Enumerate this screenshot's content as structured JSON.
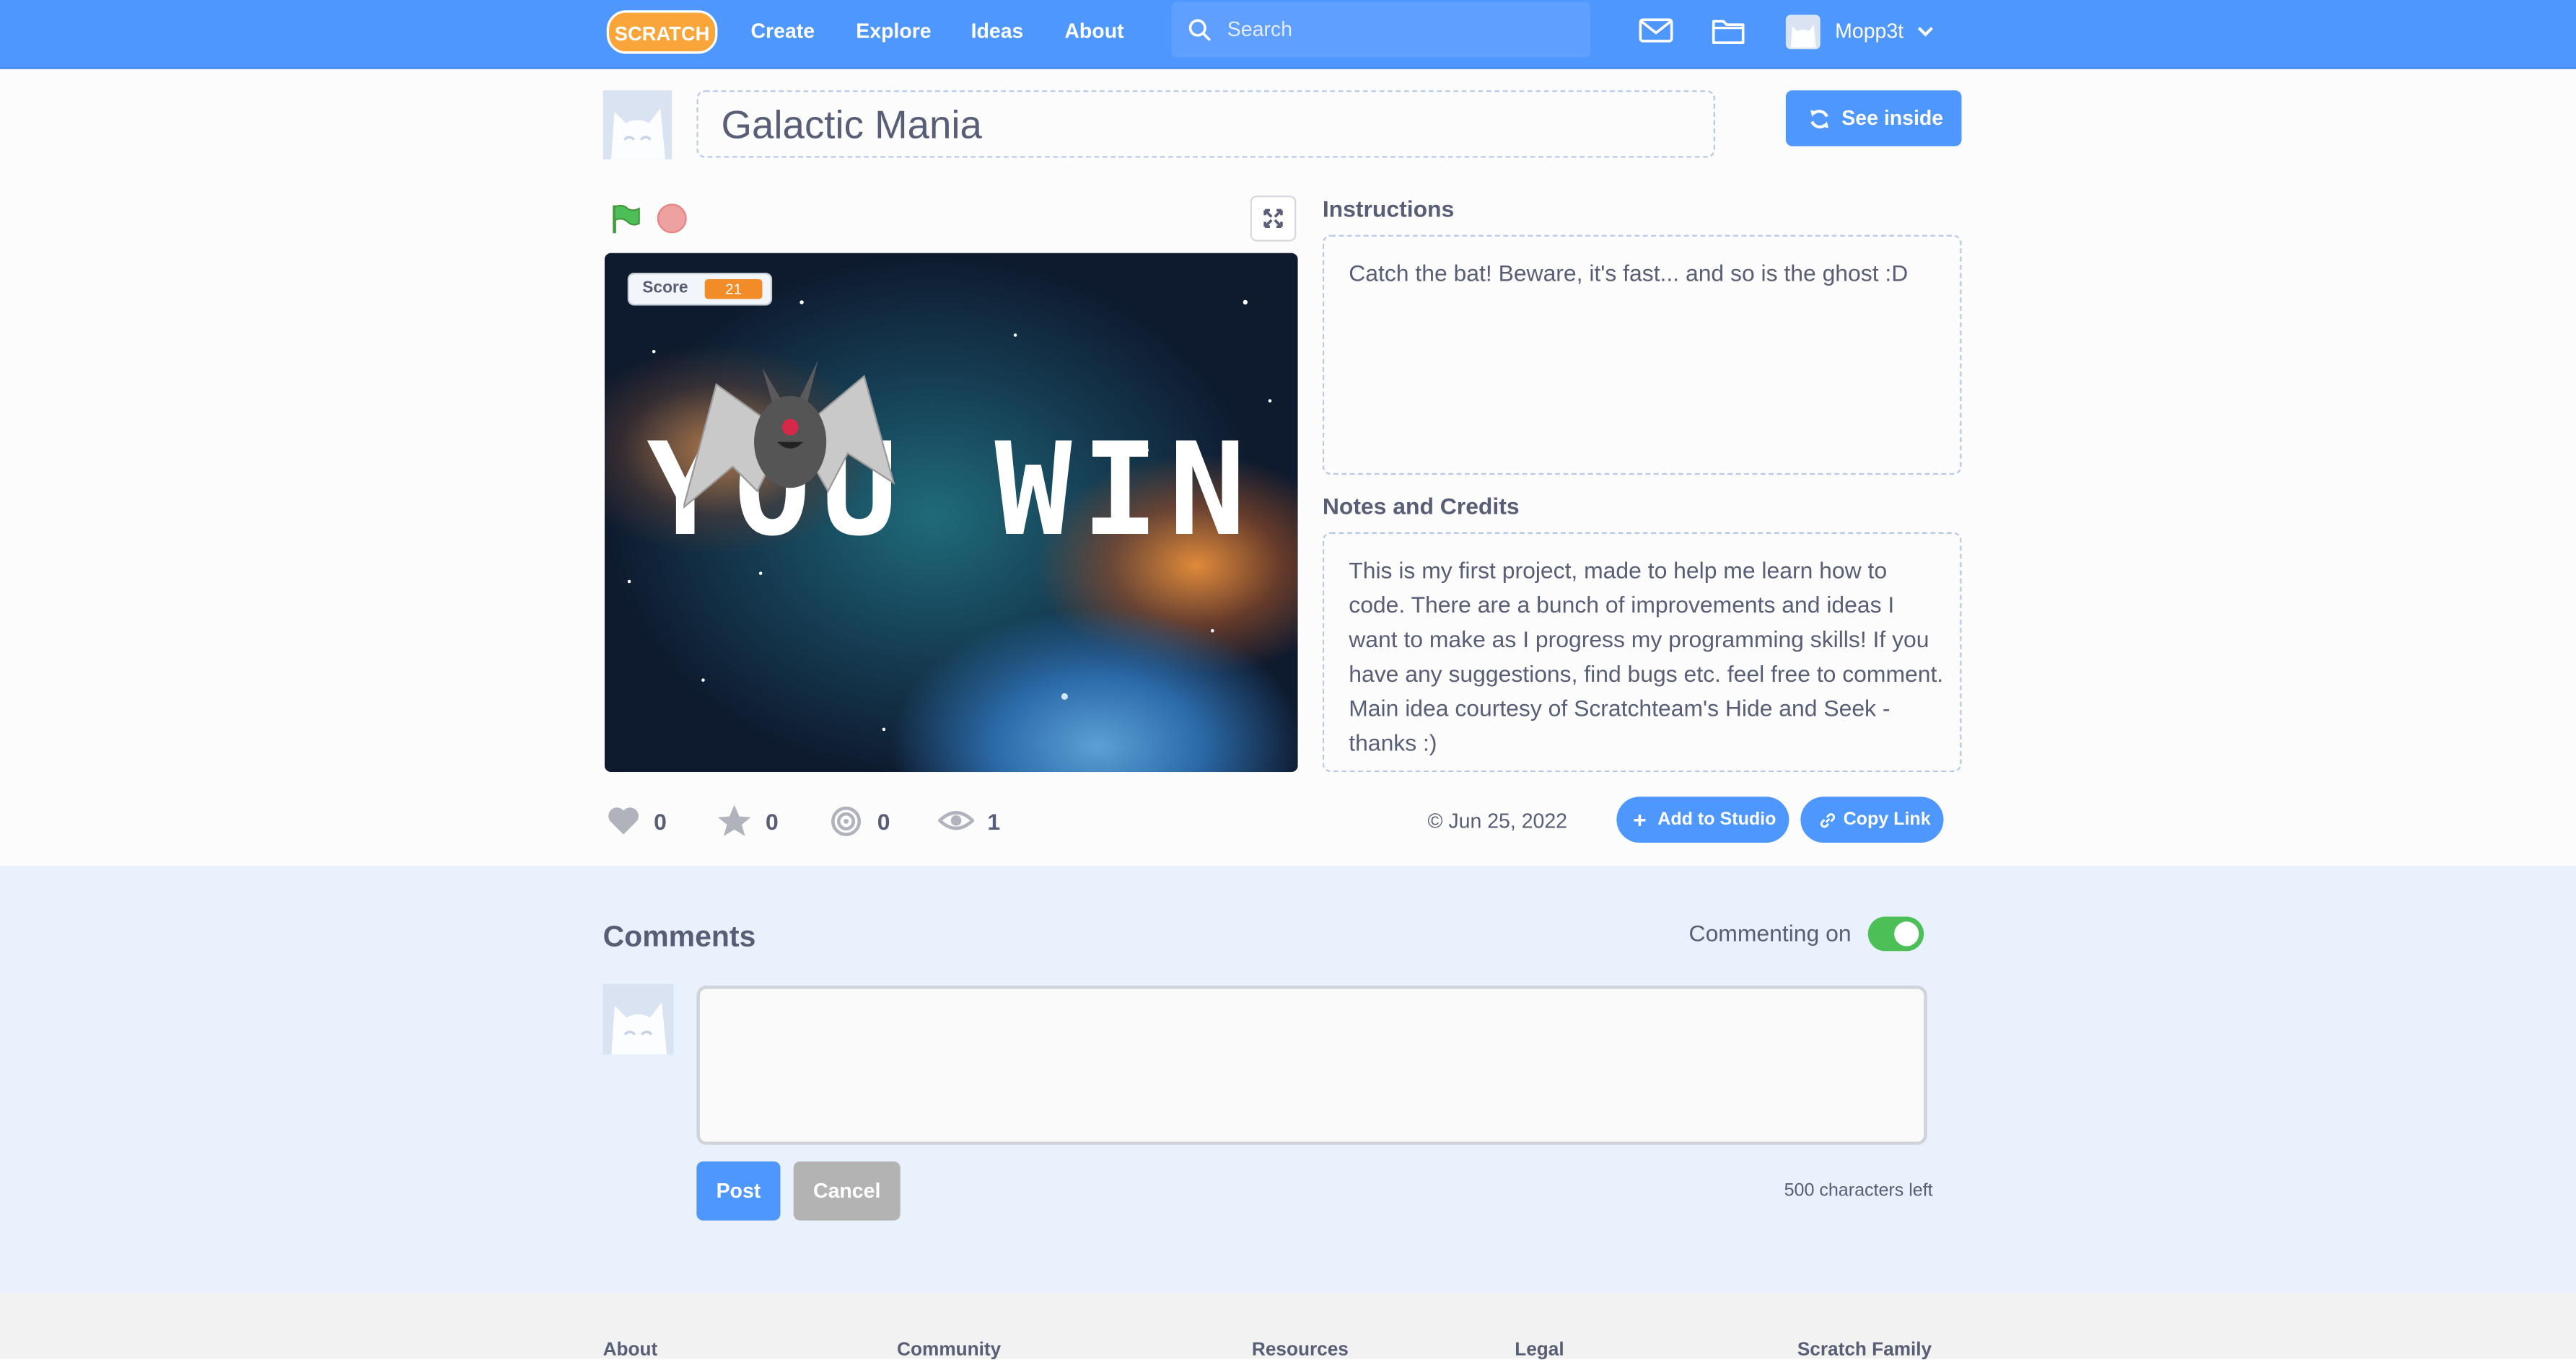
{
  "nav": {
    "logo_text": "SCRATCH",
    "links": [
      "Create",
      "Explore",
      "Ideas",
      "About"
    ],
    "search_placeholder": "Search",
    "username": "Mopp3t"
  },
  "project": {
    "title": "Galactic Mania",
    "see_inside": "See inside"
  },
  "stage": {
    "monitor_label": "Score",
    "monitor_value": "21",
    "overlay_text": "YOU WIN"
  },
  "stats": {
    "loves": "0",
    "favorites": "0",
    "remixes": "0",
    "views": "1",
    "date": "Jun 25, 2022",
    "add_to_studio": "Add to Studio",
    "copy_link": "Copy Link"
  },
  "instructions": {
    "heading": "Instructions",
    "text": "Catch the bat! Beware, it's fast... and so is the ghost :D"
  },
  "notes": {
    "heading": "Notes and Credits",
    "text": "This is my first project, made to help me learn how to code. There are a bunch of improvements and ideas I want to make as I progress my programming skills! If you have any suggestions, find bugs etc. feel free to comment. Main idea courtesy of Scratchteam's Hide and Seek - thanks :)"
  },
  "comments": {
    "heading": "Comments",
    "commenting_label": "Commenting on",
    "commenting_enabled": true,
    "post": "Post",
    "cancel": "Cancel",
    "chars_left": "500 characters left"
  },
  "footer": {
    "columns": [
      "About",
      "Community",
      "Resources",
      "Legal",
      "Scratch Family"
    ]
  },
  "colors": {
    "brand_blue": "#4d97ff",
    "score_orange": "#f28c28",
    "toggle_green": "#4cbf56"
  }
}
